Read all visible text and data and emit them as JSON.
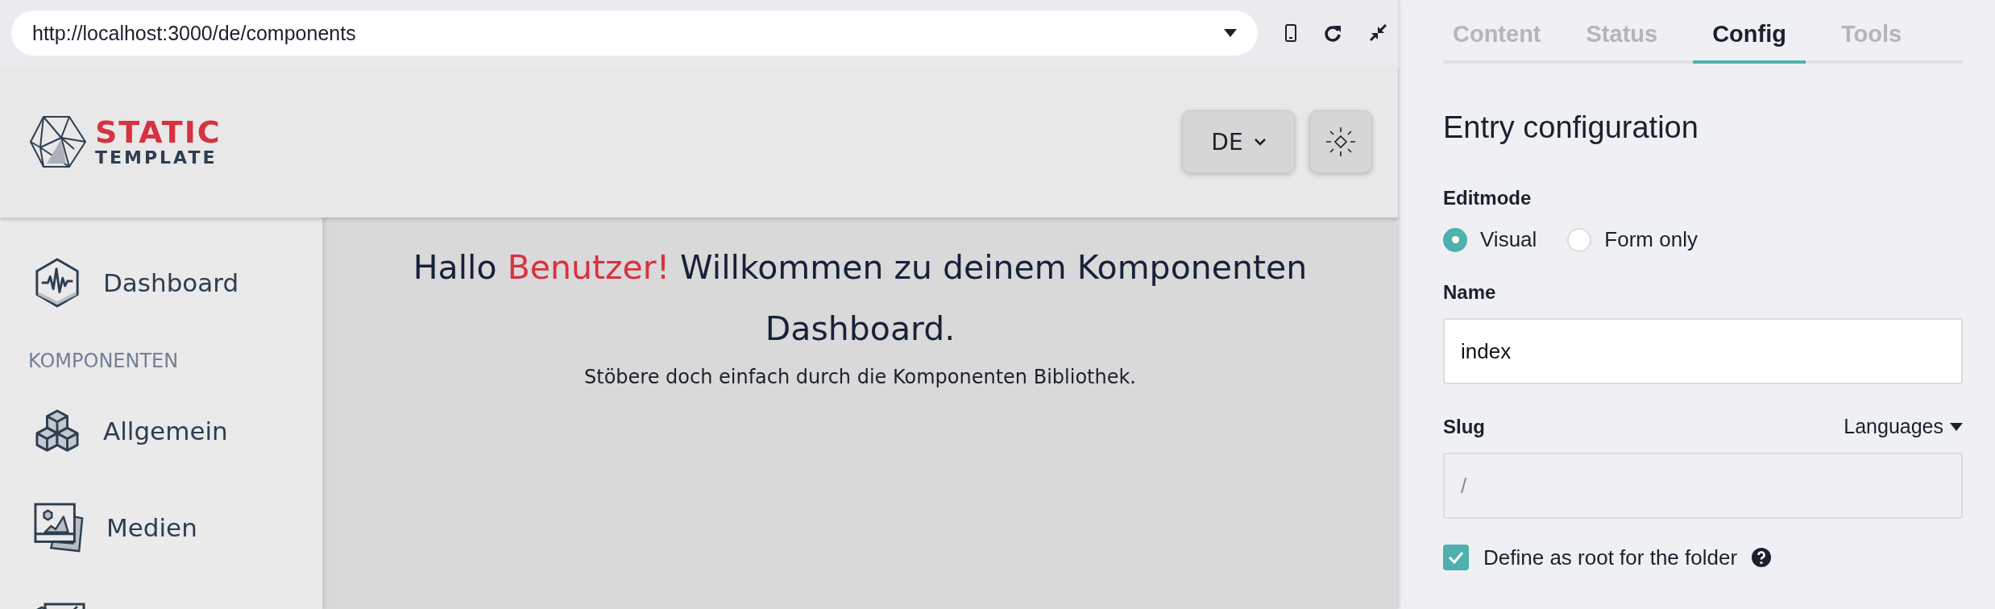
{
  "browser_bar": {
    "url": "http://localhost:3000/de/components"
  },
  "header": {
    "logo": {
      "line_1": "STATIC",
      "line_2": "TEMPLATE"
    },
    "language_button": "DE"
  },
  "sidebar": {
    "items": [
      {
        "kind": "pulse",
        "label": "Dashboard"
      },
      {
        "kind": "section",
        "label": "KOMPONENTEN"
      },
      {
        "kind": "cubes",
        "label": "Allgemein"
      },
      {
        "kind": "image",
        "label": "Medien"
      },
      {
        "kind": "chart"
      }
    ]
  },
  "main": {
    "heading": [
      {
        "text": "Hallo ",
        "highlight": false
      },
      {
        "text": "Benutzer!",
        "highlight": true
      },
      {
        "text": " Willkommen zu deinem Komponenten Dashboard.",
        "highlight": false
      }
    ],
    "subtext": "Stöbere doch einfach durch die Komponenten Bibliothek."
  },
  "panel": {
    "tabs": [
      {
        "label": "Content",
        "selected": false
      },
      {
        "label": "Status",
        "selected": false
      },
      {
        "label": "Config",
        "selected": true
      },
      {
        "label": "Tools",
        "selected": false
      }
    ],
    "title": "Entry configuration",
    "editmode": {
      "label": "Editmode",
      "options": [
        {
          "label": "Visual",
          "selected": true
        },
        {
          "label": "Form only",
          "selected": false
        }
      ]
    },
    "name": {
      "label": "Name",
      "value": "index"
    },
    "slug": {
      "label": "Slug",
      "languages": "Languages",
      "placeholder": "/"
    },
    "root_checkbox": {
      "label": "Define as root for the folder",
      "checked": true
    }
  }
}
